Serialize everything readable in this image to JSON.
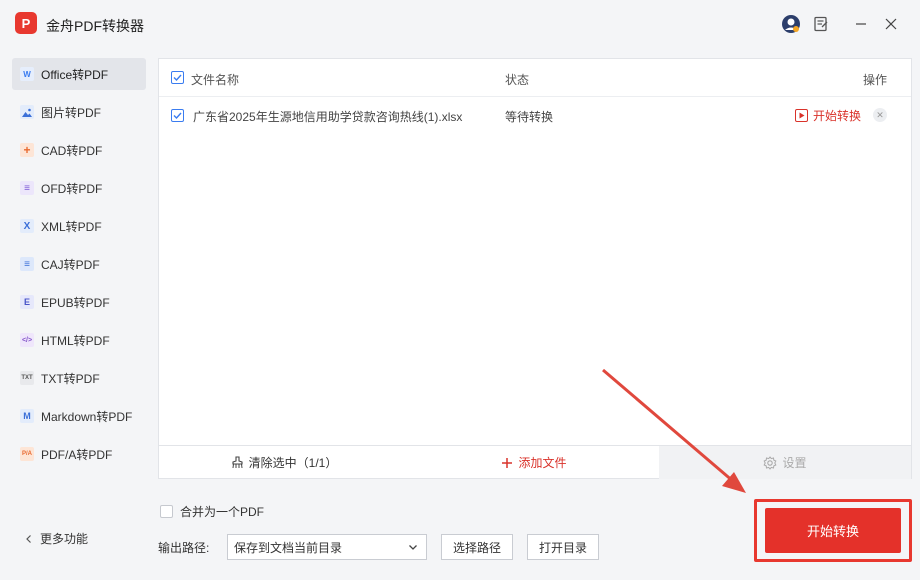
{
  "app": {
    "title": "金舟PDF转换器",
    "logo_text": "P"
  },
  "window_controls": {
    "icons": [
      "avatar-icon",
      "feedback-icon",
      "minimize-icon",
      "close-icon"
    ]
  },
  "sidebar": {
    "items": [
      {
        "label": "Office转PDF",
        "icon": "W",
        "active": true
      },
      {
        "label": "图片转PDF",
        "icon": "image"
      },
      {
        "label": "CAD转PDF",
        "icon": "+"
      },
      {
        "label": "OFD转PDF",
        "icon": "≡"
      },
      {
        "label": "XML转PDF",
        "icon": "X"
      },
      {
        "label": "CAJ转PDF",
        "icon": "≡"
      },
      {
        "label": "EPUB转PDF",
        "icon": "E"
      },
      {
        "label": "HTML转PDF",
        "icon": "</>"
      },
      {
        "label": "TXT转PDF",
        "icon": "TXT"
      },
      {
        "label": "Markdown转PDF",
        "icon": "M"
      },
      {
        "label": "PDF/A转PDF",
        "icon": "P/A"
      }
    ],
    "more_label": "更多功能"
  },
  "table": {
    "headers": {
      "name": "文件名称",
      "status": "状态",
      "action": "操作"
    },
    "rows": [
      {
        "name": "广东省2025年生源地信用助学贷款咨询热线(1).xlsx",
        "status": "等待转换",
        "action": "开始转换"
      }
    ]
  },
  "footer": {
    "clear_label": "清除选中（1/1）",
    "add_label": "添加文件",
    "settings_label": "设置"
  },
  "options": {
    "merge_label": "合并为一个PDF",
    "output_label": "输出路径:",
    "output_value": "保存到文档当前目录",
    "choose_path": "选择路径",
    "open_dir": "打开目录"
  },
  "start_button": "开始转换",
  "colors": {
    "accent": "#e4312a",
    "check": "#3a7cf0"
  }
}
